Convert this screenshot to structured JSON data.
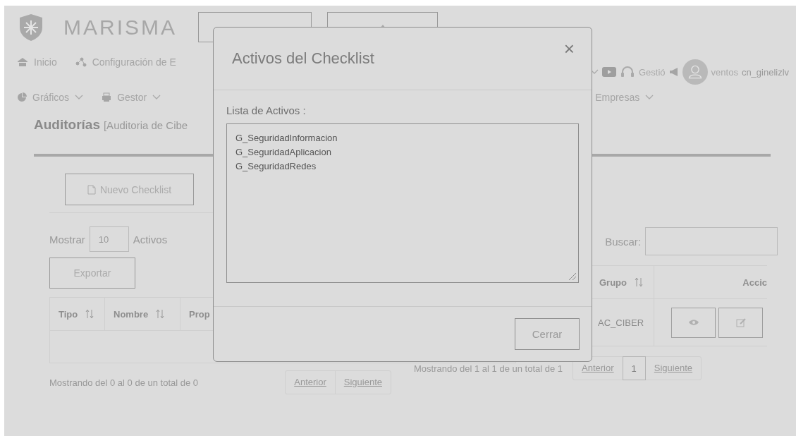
{
  "header": {
    "brand": "MARISMA",
    "buttons": [
      {
        "kind": "plain"
      },
      {
        "kind": "up"
      }
    ]
  },
  "nav_primary": [
    {
      "label": "Inicio"
    },
    {
      "label": "Configuración de E"
    }
  ],
  "nav_right": {
    "gestion_label": "Gestió",
    "eventos_label": "ventos",
    "user": "cn_ginelizlv"
  },
  "nav_secondary": [
    {
      "label": "Gráficos",
      "dropdown": true
    },
    {
      "label": "Gestor",
      "dropdown": true
    },
    {
      "label": "Empresas",
      "dropdown": true
    }
  ],
  "page_title": {
    "title": "Auditorías",
    "subtitle": "[Auditoria de Cibe"
  },
  "left_panel": {
    "new_button": "Nuevo Checklist",
    "length": {
      "prefix": "Mostrar",
      "value": "10",
      "suffix": "Activos"
    },
    "export_button": "Exportar",
    "columns": [
      {
        "label": "Tipo",
        "sortable": true
      },
      {
        "label": "Nombre",
        "sortable": true
      },
      {
        "label": "Prop"
      }
    ],
    "info": "Mostrando del 0 al 0 de un total de 0",
    "pagination": {
      "previous": "Anterior",
      "next": "Siguiente"
    }
  },
  "right_panel": {
    "search_label": "Buscar:",
    "columns": [
      {
        "label": "Grupo",
        "sortable": true
      },
      {
        "label": "Accic",
        "sortable": false
      }
    ],
    "rows": [
      {
        "group": "AC_CIBER"
      }
    ],
    "info": "Mostrando del 1 al 1 de un total de 1",
    "pagination": {
      "previous": "Anterior",
      "current": "1",
      "next": "Siguiente"
    }
  },
  "modal": {
    "title": "Activos del Checklist",
    "close": "×",
    "list_label": "Lista de Activos :",
    "items": [
      "G_SeguridadInformacion",
      "G_SeguridadAplicacion",
      "G_SeguridadRedes"
    ],
    "close_button": "Cerrar"
  }
}
